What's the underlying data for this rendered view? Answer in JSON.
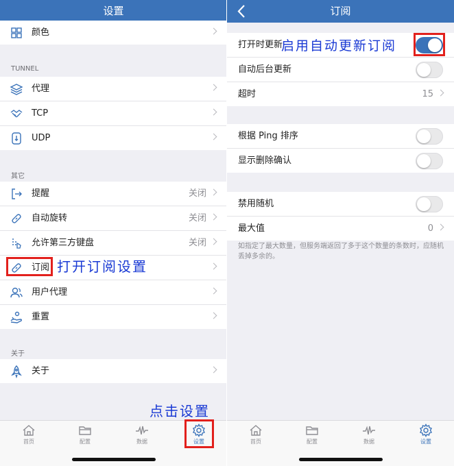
{
  "left": {
    "nav_title": "设置",
    "group0": [
      {
        "label": "颜色",
        "icon": "grid-icon"
      }
    ],
    "tunnel_header": "TUNNEL",
    "tunnel": [
      {
        "label": "代理",
        "icon": "layers-icon"
      },
      {
        "label": "TCP",
        "icon": "handshake-icon"
      },
      {
        "label": "UDP",
        "icon": "udp-icon"
      }
    ],
    "other_header": "其它",
    "other": [
      {
        "label": "提醒",
        "value": "关闭",
        "icon": "exit-icon"
      },
      {
        "label": "自动旋转",
        "value": "关闭",
        "icon": "link-icon"
      },
      {
        "label": "允许第三方键盘",
        "value": "关闭",
        "icon": "keyboard-icon"
      },
      {
        "label": "订阅",
        "value": "",
        "icon": "link-icon"
      },
      {
        "label": "用户代理",
        "value": "",
        "icon": "users-icon"
      },
      {
        "label": "重置",
        "value": "",
        "icon": "reset-icon"
      }
    ],
    "about_header": "关于",
    "about": [
      {
        "label": "关于",
        "icon": "rocket-icon"
      }
    ],
    "annotations": {
      "subscribe": "打开订阅设置",
      "settings": "点击设置"
    }
  },
  "right": {
    "nav_title": "订阅",
    "group1": [
      {
        "label": "打开时更新",
        "type": "toggle",
        "on": true
      },
      {
        "label": "自动后台更新",
        "type": "toggle",
        "on": false
      },
      {
        "label": "超时",
        "type": "value",
        "value": "15"
      }
    ],
    "group2": [
      {
        "label": "根据 Ping 排序",
        "type": "toggle",
        "on": false
      },
      {
        "label": "显示删除确认",
        "type": "toggle",
        "on": false
      }
    ],
    "group3": [
      {
        "label": "禁用随机",
        "type": "toggle",
        "on": false
      },
      {
        "label": "最大值",
        "type": "value",
        "value": "0"
      }
    ],
    "note": "如指定了最大数量，但服务端返回了多于这个数量的条数时，应随机丢掉多余的。",
    "annotation": "启用自动更新订阅"
  },
  "tabs": [
    {
      "label": "首页",
      "icon": "home-icon"
    },
    {
      "label": "配置",
      "icon": "folder-icon"
    },
    {
      "label": "数据",
      "icon": "pulse-icon"
    },
    {
      "label": "设置",
      "icon": "gear-icon"
    }
  ],
  "colors": {
    "accent": "#3b73b9",
    "highlight": "#e2201c",
    "annotation": "#1a3ad4"
  }
}
